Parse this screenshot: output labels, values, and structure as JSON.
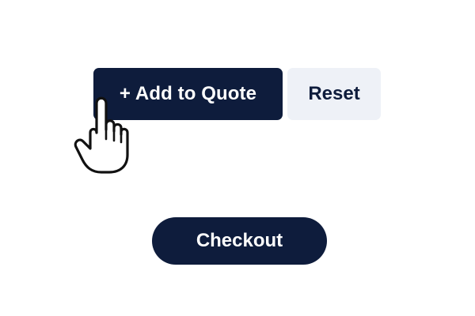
{
  "colors": {
    "primary": "#0e1c3c",
    "primary_text": "#ffffff",
    "secondary_bg": "#eef1f7",
    "secondary_text": "#0e1c3c",
    "background": "#ffffff"
  },
  "actions": {
    "add_to_quote_label": "+ Add to Quote",
    "reset_label": "Reset",
    "checkout_label": "Checkout"
  },
  "cursor": {
    "icon": "hand-pointer-icon"
  }
}
